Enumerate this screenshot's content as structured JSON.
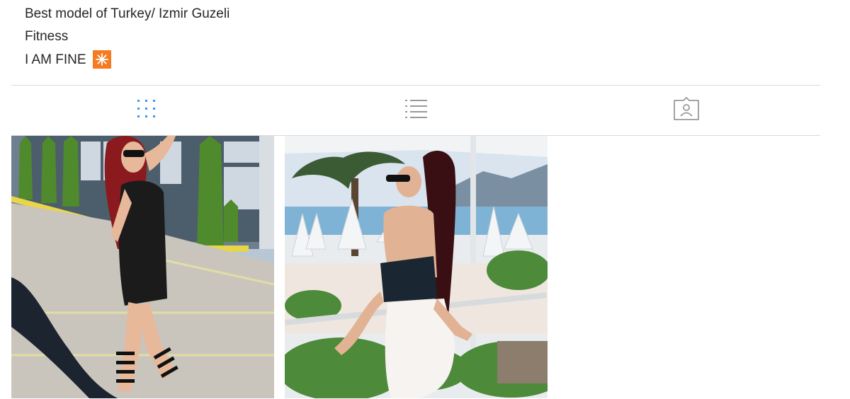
{
  "bio": {
    "lines": [
      "Best model of Turkey/ Izmir Guzeli",
      "Fitness",
      "I AM FINE"
    ],
    "emoji": "eight-pointed-star-icon"
  },
  "tabs": [
    {
      "name": "grid-view",
      "icon": "grid-icon",
      "active": true
    },
    {
      "name": "list-view",
      "icon": "list-icon",
      "active": false
    },
    {
      "name": "tagged",
      "icon": "tagged-person-icon",
      "active": false
    }
  ],
  "colors": {
    "active_tab": "#3897f0",
    "inactive_tab": "#999999",
    "divider": "#dbdbdb",
    "emoji_bg": "#f47b20"
  },
  "posts": [
    {
      "alt": "photo-1"
    },
    {
      "alt": "photo-2"
    }
  ]
}
